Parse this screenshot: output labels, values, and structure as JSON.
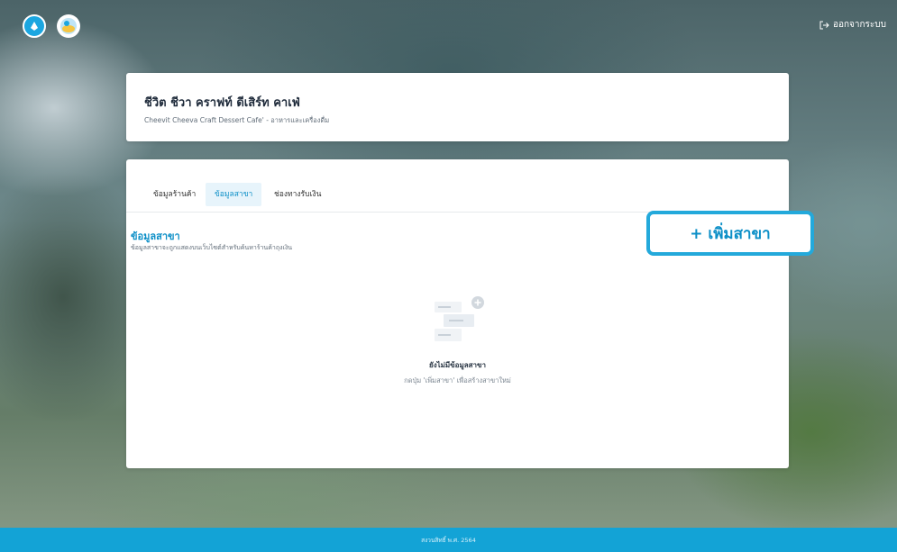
{
  "header": {
    "logout_label": "ออกจากระบบ",
    "logout_icon": "logout-icon"
  },
  "store": {
    "name": "ชีวิต ชีวา คราฟท์ ดีเสิร์ท คาเฟ่",
    "subtitle": "Cheevit Cheeva Craft Dessert Cafe' - อาหารและเครื่องดื่ม"
  },
  "tabs": [
    {
      "label": "ข้อมูลร้านค้า",
      "active": false
    },
    {
      "label": "ข้อมูลสาขา",
      "active": true
    },
    {
      "label": "ช่องทางรับเงิน",
      "active": false
    }
  ],
  "section": {
    "title": "ข้อมูลสาขา",
    "description": "ข้อมูลสาขาจะถูกแสดงบนเว็บไซต์สำหรับค้นหาร้านค้าถุงเงิน",
    "add_button_label": "+ เพิ่มสาขา"
  },
  "empty_state": {
    "icon": "empty-list-icon",
    "title": "ยังไม่มีข้อมูลสาขา",
    "description": "กดปุ่ม 'เพิ่มสาขา' เพื่อสร้างสาขาใหม่"
  },
  "footer": {
    "text": "สงวนสิทธิ์ พ.ศ. 2564"
  },
  "colors": {
    "accent": "#0c8fc7",
    "highlight_border": "#23a9db",
    "footer": "#13a3d6"
  }
}
